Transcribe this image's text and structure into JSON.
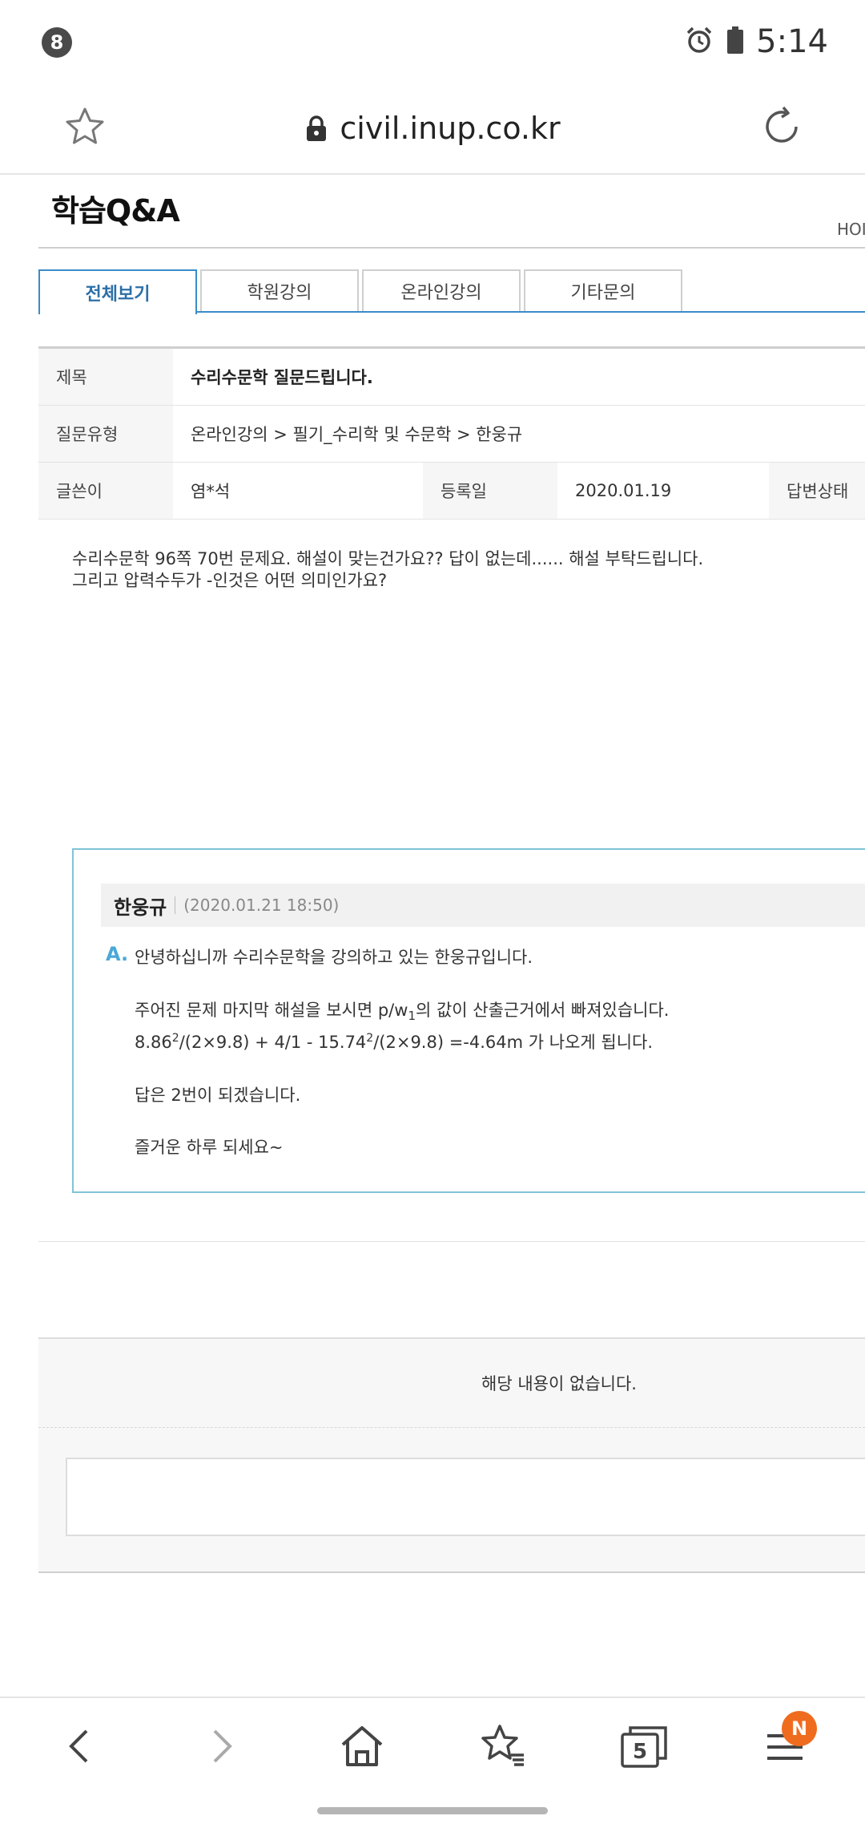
{
  "status_bar": {
    "notification_count": "8",
    "time": "5:14"
  },
  "browser": {
    "url": "civil.inup.co.kr"
  },
  "page": {
    "title": "학습Q&A",
    "home_crumb": "HOI"
  },
  "tabs": [
    {
      "label": "전체보기",
      "active": true
    },
    {
      "label": "학원강의",
      "active": false
    },
    {
      "label": "온라인강의",
      "active": false
    },
    {
      "label": "기타문의",
      "active": false
    }
  ],
  "info": {
    "title_label": "제목",
    "title_value": "수리수문학 질문드립니다.",
    "type_label": "질문유형",
    "type_value": "온라인강의 > 필기_수리학 및 수문학 > 한웅규",
    "author_label": "글쓴이",
    "author_value": "염*석",
    "date_label": "등록일",
    "date_value": "2020.01.19",
    "status_label": "답변상태"
  },
  "question": {
    "line1": "수리수문학 96쪽  70번  문제요. 해설이 맞는건가요?? 답이 없는데...... 해설 부탁드립니다.",
    "line2": "그리고 압력수두가 -인것은 어떤 의미인가요?"
  },
  "answer": {
    "name": "한웅규",
    "date": "(2020.01.21 18:50)",
    "marker": "A.",
    "line1": "안녕하십니까 수리수문학을 강의하고 있는 한웅규입니다.",
    "line2a": "주어진 문제 마지막 해설을 보시면 p/w",
    "line2sub": "1",
    "line2b": "의 값이 산출근거에서 빠져있습니다.",
    "line3a": "8.86",
    "line3sup1": "2",
    "line3b": "/(2×9.8) + 4/1 - 15.74",
    "line3sup2": "2",
    "line3c": "/(2×9.8) =-4.64m 가 나오게 됩니다.",
    "line4": "답은 2번이 되겠습니다.",
    "line5": "즐거운 하루 되세요~"
  },
  "comments": {
    "empty_message": "해당 내용이 없습니다."
  },
  "bottom_nav": {
    "tab_count": "5",
    "menu_badge": "N"
  }
}
